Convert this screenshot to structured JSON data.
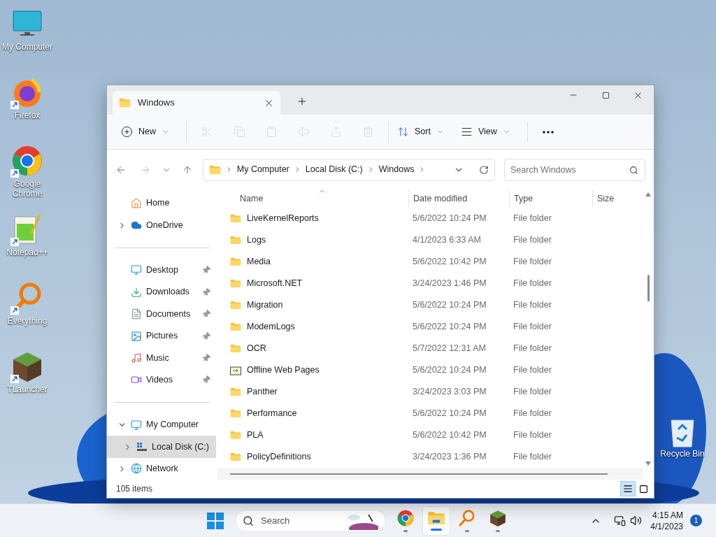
{
  "desktop_icons": [
    {
      "kind": "computer",
      "label": "My Computer",
      "shortcut": false
    },
    {
      "kind": "firefox",
      "label": "Firefox",
      "shortcut": true
    },
    {
      "kind": "chrome",
      "label": "Google Chrome",
      "shortcut": true
    },
    {
      "kind": "notepad",
      "label": "Notepad++",
      "shortcut": true
    },
    {
      "kind": "everything",
      "label": "Everything",
      "shortcut": true
    },
    {
      "kind": "tlauncher",
      "label": "TLauncher",
      "shortcut": true
    }
  ],
  "recycle_bin": {
    "label": "Recycle Bin"
  },
  "window": {
    "tab": {
      "title": "Windows"
    },
    "toolbar": [
      {
        "kind": "new",
        "label": "New",
        "disabled": false
      },
      {
        "kind": "cut",
        "disabled": true
      },
      {
        "kind": "copy",
        "disabled": true
      },
      {
        "kind": "paste",
        "disabled": true
      },
      {
        "kind": "rename",
        "disabled": true
      },
      {
        "kind": "share",
        "disabled": true
      },
      {
        "kind": "delete",
        "disabled": true
      },
      {
        "kind": "sort",
        "label": "Sort",
        "disabled": false
      },
      {
        "kind": "view",
        "label": "View",
        "disabled": false
      },
      {
        "kind": "more",
        "disabled": false
      }
    ],
    "breadcrumbs": [
      "My Computer",
      "Local Disk (C:)",
      "Windows"
    ],
    "search": {
      "placeholder": "Search Windows"
    },
    "sidebar": [
      {
        "kind": "home",
        "label": "Home",
        "pinned": false,
        "selected": false
      },
      {
        "kind": "onedrive",
        "label": "OneDrive",
        "pinned": false,
        "selected": false,
        "expanded": false
      },
      {
        "kind": "divider"
      },
      {
        "kind": "desktop",
        "label": "Desktop",
        "pinned": true,
        "selected": false
      },
      {
        "kind": "downloads",
        "label": "Downloads",
        "pinned": true,
        "selected": false
      },
      {
        "kind": "documents",
        "label": "Documents",
        "pinned": true,
        "selected": false
      },
      {
        "kind": "pictures",
        "label": "Pictures",
        "pinned": true,
        "selected": false
      },
      {
        "kind": "music",
        "label": "Music",
        "pinned": true,
        "selected": false
      },
      {
        "kind": "videos",
        "label": "Videos",
        "pinned": true,
        "selected": false
      },
      {
        "kind": "divider"
      },
      {
        "kind": "computer",
        "label": "My Computer",
        "pinned": false,
        "selected": false,
        "expanded": true,
        "children": [
          {
            "kind": "disk",
            "label": "Local Disk (C:)",
            "pinned": false,
            "selected": true,
            "expanded": false
          }
        ]
      },
      {
        "kind": "network",
        "label": "Network",
        "pinned": false,
        "selected": false,
        "expanded": false
      }
    ],
    "columns": [
      {
        "label": "Name",
        "sorted": true
      },
      {
        "label": "Date modified",
        "sorted": false
      },
      {
        "label": "Type",
        "sorted": false
      },
      {
        "label": "Size",
        "sorted": false
      }
    ],
    "rows": [
      {
        "kind": "folder",
        "name": "LiveKernelReports",
        "date": "5/6/2022 10:24 PM",
        "type": "File folder"
      },
      {
        "kind": "folder",
        "name": "Logs",
        "date": "4/1/2023 6:33 AM",
        "type": "File folder"
      },
      {
        "kind": "folder",
        "name": "Media",
        "date": "5/6/2022 10:42 PM",
        "type": "File folder"
      },
      {
        "kind": "folder",
        "name": "Microsoft.NET",
        "date": "3/24/2023 1:46 PM",
        "type": "File folder"
      },
      {
        "kind": "folder",
        "name": "Migration",
        "date": "5/6/2022 10:24 PM",
        "type": "File folder"
      },
      {
        "kind": "folder",
        "name": "ModemLogs",
        "date": "5/6/2022 10:24 PM",
        "type": "File folder"
      },
      {
        "kind": "folder",
        "name": "OCR",
        "date": "5/7/2022 12:31 AM",
        "type": "File folder"
      },
      {
        "kind": "offline",
        "name": "Offline Web Pages",
        "date": "5/6/2022 10:24 PM",
        "type": "File folder"
      },
      {
        "kind": "folder",
        "name": "Panther",
        "date": "3/24/2023 3:03 PM",
        "type": "File folder"
      },
      {
        "kind": "folder",
        "name": "Performance",
        "date": "5/6/2022 10:24 PM",
        "type": "File folder"
      },
      {
        "kind": "folder",
        "name": "PLA",
        "date": "5/6/2022 10:42 PM",
        "type": "File folder"
      },
      {
        "kind": "folder",
        "name": "PolicyDefinitions",
        "date": "3/24/2023 1:36 PM",
        "type": "File folder"
      }
    ],
    "status": "105 items",
    "view_modes": [
      {
        "kind": "details",
        "selected": true
      },
      {
        "kind": "tiles",
        "selected": false
      }
    ]
  },
  "taskbar": {
    "search_placeholder": "Search",
    "apps": [
      {
        "kind": "chrome",
        "running": true,
        "active": false
      },
      {
        "kind": "explorer",
        "running": true,
        "active": true
      },
      {
        "kind": "everything",
        "running": true,
        "active": false
      },
      {
        "kind": "tlauncher",
        "running": true,
        "active": false
      }
    ],
    "time": "4:15 AM",
    "date": "4/1/2023",
    "notifications": "1"
  }
}
